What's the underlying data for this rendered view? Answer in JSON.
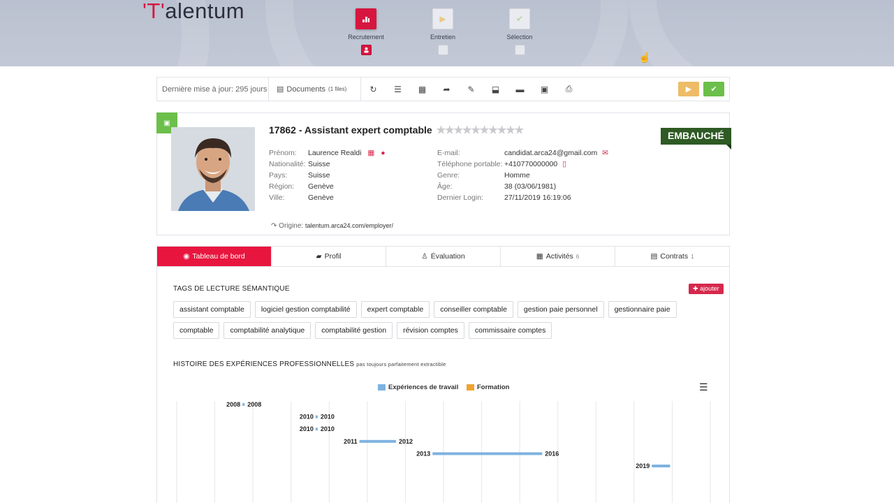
{
  "brand": {
    "logo_mark": "'T'",
    "logo_text": "alentum",
    "accent": "#d6163f"
  },
  "stages": [
    {
      "label": "Recrutement",
      "icon": "chart-icon",
      "active": true
    },
    {
      "label": "Entretien",
      "icon": "play-icon",
      "active": false
    },
    {
      "label": "Sélection",
      "icon": "check-icon",
      "active": false
    }
  ],
  "toolbar": {
    "last_update": "Dernière mise à jour: 295 jours",
    "documents_label": "Documents",
    "documents_count": "(1 files)",
    "icons": [
      "refresh-icon",
      "list-icon",
      "newspaper-icon",
      "share-icon",
      "pencil-icon",
      "inbox-icon",
      "archive-icon",
      "id-card-icon",
      "print-icon"
    ]
  },
  "candidate": {
    "title": "17862 - Assistant expert comptable",
    "stars": "★★★★★★★★★★",
    "status": "EMBAUCHÉ",
    "left_fields": [
      {
        "k": "Prénom:",
        "v": "Laurence Realdi"
      },
      {
        "k": "Nationalité:",
        "v": "Suisse"
      },
      {
        "k": "Pays:",
        "v": "Suisse"
      },
      {
        "k": "Région:",
        "v": "Genève"
      },
      {
        "k": "Ville:",
        "v": "Genève"
      }
    ],
    "right_fields": [
      {
        "k": "E-mail:",
        "v": "candidat.arca24@gmail.com"
      },
      {
        "k": "Téléphone portable:",
        "v": "+410770000000"
      },
      {
        "k": "Genre:",
        "v": "Homme"
      },
      {
        "k": "Âge:",
        "v": "38 (03/06/1981)"
      },
      {
        "k": "Dernier Login:",
        "v": "27/11/2019 16:19:06"
      }
    ],
    "origin_label": "Origine:",
    "origin_value": "talentum.arca24.com/employer/"
  },
  "tabs": [
    {
      "label": "Tableau de bord",
      "count": "",
      "active": true
    },
    {
      "label": "Profil",
      "count": ""
    },
    {
      "label": "Évaluation",
      "count": ""
    },
    {
      "label": "Activités",
      "count": "6"
    },
    {
      "label": "Contrats",
      "count": "1"
    }
  ],
  "tags_section": {
    "title": "TAGS DE LECTURE SÉMANTIQUE",
    "add_label": "ajouter",
    "tags": [
      "assistant comptable",
      "logiciel gestion comptabilité",
      "expert comptable",
      "conseiller comptable",
      "gestion paie personnel",
      "gestionnaire paie",
      "comptable",
      "comptabilité analytique",
      "comptabilité gestion",
      "révision comptes",
      "commissaire comptes"
    ]
  },
  "history_section": {
    "title": "HISTOIRE DES EXPÉRIENCES PROFESSIONNELLES",
    "subtitle": "pas toujours parfaitement extractible"
  },
  "chart_data": {
    "type": "bar",
    "orientation": "horizontal-timeline",
    "series": [
      {
        "name": "Expériences de travail",
        "color": "#7eb3e0"
      },
      {
        "name": "Formation",
        "color": "#f0a330"
      }
    ],
    "x_range": [
      2006.2,
      2020.8
    ],
    "bars": [
      {
        "start": 2008,
        "end": 2008,
        "start_label": "2008",
        "end_label": "2008",
        "series": "Expériences de travail"
      },
      {
        "start": 2010,
        "end": 2010,
        "start_label": "2010",
        "end_label": "2010",
        "series": "Expériences de travail"
      },
      {
        "start": 2010,
        "end": 2010,
        "start_label": "2010",
        "end_label": "2010",
        "series": "Expériences de travail"
      },
      {
        "start": 2011.2,
        "end": 2012.2,
        "start_label": "2011",
        "end_label": "2012",
        "series": "Expériences de travail"
      },
      {
        "start": 2013.2,
        "end": 2016.2,
        "start_label": "2013",
        "end_label": "2016",
        "series": "Expériences de travail"
      },
      {
        "start": 2019.2,
        "end": 2019.7,
        "start_label": "2019",
        "end_label": "",
        "series": "Expériences de travail"
      }
    ]
  }
}
